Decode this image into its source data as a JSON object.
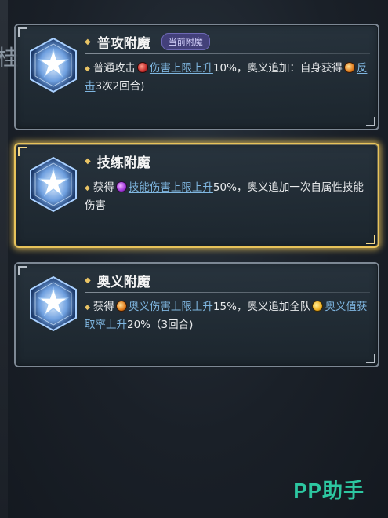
{
  "left_edge_char": "桂",
  "cards": [
    {
      "title": "普攻附魔",
      "badge": "当前附魔",
      "selected": false,
      "desc": {
        "pre": "普通攻击",
        "icon1": "red-buff-icon",
        "kw1": "伤害上限上升",
        "mid": "10%，奥义追加：自身获得",
        "icon2": "counter-icon",
        "kw2": "反击",
        "post": "3次2回合)"
      }
    },
    {
      "title": "技练附魔",
      "badge": "",
      "selected": true,
      "desc": {
        "pre": "获得",
        "icon1": "skill-buff-icon",
        "kw1": "技能伤害上限上升",
        "mid": "50%，奥义追加一次自属性技能伤害"
      }
    },
    {
      "title": "奥义附魔",
      "badge": "",
      "selected": false,
      "desc": {
        "pre": "获得",
        "icon1": "ultimate-buff-icon",
        "kw1": "奥义伤害上限上升",
        "mid": "15%，奥义追加全队",
        "icon2": "charge-icon",
        "kw2": "奥义值获取率上升",
        "post": "20%（3回合)"
      }
    }
  ],
  "watermark": "PP助手",
  "colors": {
    "selected_border": "#e8c35a",
    "keyword": "#7fb6e0",
    "badge_bg": "#43407a",
    "watermark": "#2fd1a8"
  }
}
